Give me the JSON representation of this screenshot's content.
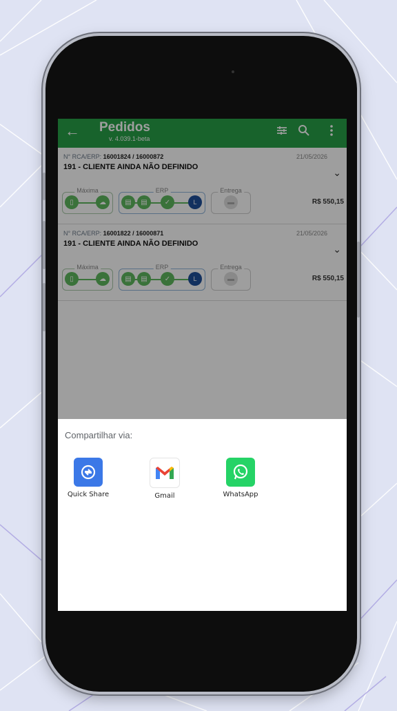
{
  "app_bar": {
    "title": "Pedidos",
    "version": "v. 4.039.1-beta",
    "back_icon": "arrow-left-icon",
    "actions": [
      "filter-sliders-icon",
      "search-icon",
      "more-vert-icon"
    ],
    "color": "#27a147"
  },
  "orders": [
    {
      "rca_label": "N° RCA/ERP:",
      "rca_value": "16001824 / 16000872",
      "date": "21/05/2026",
      "client": "191 - CLIENTE AINDA NÃO DEFINIDO",
      "price": "R$ 550,15",
      "stages": {
        "maxima": "Máxima",
        "erp": "ERP",
        "entrega": "Entrega"
      },
      "erp_badge": "L"
    },
    {
      "rca_label": "N° RCA/ERP:",
      "rca_value": "16001822 / 16000871",
      "date": "21/05/2026",
      "client": "191 - CLIENTE AINDA NÃO DEFINIDO",
      "price": "R$ 550,15",
      "stages": {
        "maxima": "Máxima",
        "erp": "ERP",
        "entrega": "Entrega"
      },
      "erp_badge": "L"
    }
  ],
  "share_sheet": {
    "title": "Compartilhar via:",
    "apps": [
      {
        "name": "Quick Share",
        "icon": "quick-share-icon",
        "color": "#3b78e7"
      },
      {
        "name": "Gmail",
        "icon": "gmail-icon",
        "color": "#ffffff"
      },
      {
        "name": "WhatsApp",
        "icon": "whatsapp-icon",
        "color": "#25d366"
      }
    ]
  }
}
